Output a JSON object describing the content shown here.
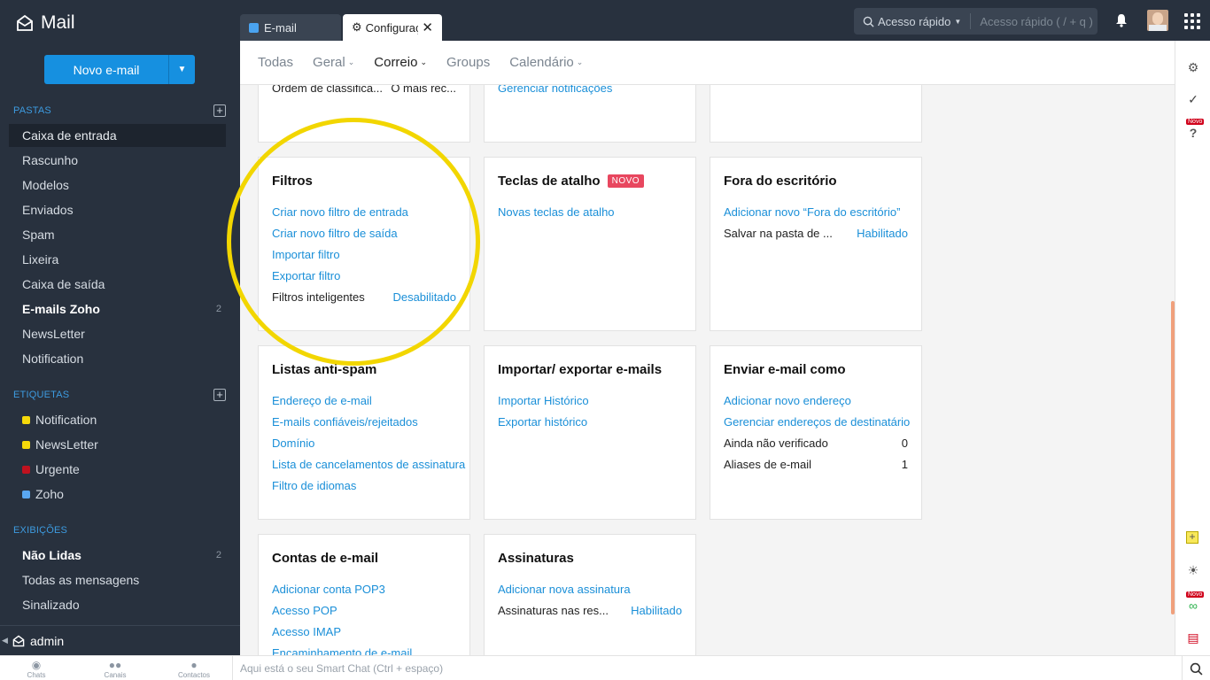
{
  "app": {
    "title": "Mail"
  },
  "sidebar": {
    "new_mail": "Novo e-mail",
    "folders_title": "PASTAS",
    "folders": [
      {
        "label": "Caixa de entrada",
        "count": ""
      },
      {
        "label": "Rascunho",
        "count": ""
      },
      {
        "label": "Modelos",
        "count": ""
      },
      {
        "label": "Enviados",
        "count": ""
      },
      {
        "label": "Spam",
        "count": ""
      },
      {
        "label": "Lixeira",
        "count": ""
      },
      {
        "label": "Caixa de saída",
        "count": ""
      },
      {
        "label": "E-mails Zoho",
        "count": "2"
      },
      {
        "label": "NewsLetter",
        "count": ""
      },
      {
        "label": "Notification",
        "count": ""
      }
    ],
    "tags_title": "ETIQUETAS",
    "tags": [
      {
        "label": "Notification",
        "color": "#f5d90a"
      },
      {
        "label": "NewsLetter",
        "color": "#f5d90a"
      },
      {
        "label": "Urgente",
        "color": "#c0121f"
      },
      {
        "label": "Zoho",
        "color": "#5aa7f0"
      }
    ],
    "views_title": "EXIBIÇÕES",
    "views": [
      {
        "label": "Não Lidas",
        "count": "2"
      },
      {
        "label": "Todas as mensagens",
        "count": ""
      },
      {
        "label": "Sinalizado",
        "count": ""
      }
    ],
    "user": "admin"
  },
  "tabs": {
    "email": "E-mail",
    "config": "Configurações"
  },
  "search": {
    "quick": "Acesso rápido",
    "placeholder": "Acesso rápido  ( / + q )"
  },
  "subnav": {
    "all": "Todas",
    "general": "Geral",
    "mail": "Correio",
    "groups": "Groups",
    "calendar": "Calendário"
  },
  "cards": {
    "top1": {
      "k": "Ordem de classifica...",
      "v": "O mais rec..."
    },
    "top2": {
      "link": "Gerenciar notificações"
    },
    "filters": {
      "title": "Filtros",
      "links": [
        "Criar novo filtro de entrada",
        "Criar novo filtro de saída",
        "Importar filtro",
        "Exportar filtro"
      ],
      "k": "Filtros inteligentes",
      "v": "Desabilitado"
    },
    "shortcuts": {
      "title": "Teclas de atalho",
      "badge": "NOVO",
      "links": [
        "Novas teclas de atalho"
      ]
    },
    "ooo": {
      "title": "Fora do escritório",
      "links": [
        "Adicionar novo “Fora do escritório”"
      ],
      "k": "Salvar na pasta de ...",
      "v": "Habilitado"
    },
    "antispam": {
      "title": "Listas anti-spam",
      "links": [
        "Endereço de e-mail",
        "E-mails confiáveis/rejeitados",
        "Domínio",
        "Lista de cancelamentos de assinatura",
        "Filtro de idiomas"
      ]
    },
    "importexport": {
      "title": "Importar/ exportar e-mails",
      "links": [
        "Importar Histórico",
        "Exportar histórico"
      ]
    },
    "sendas": {
      "title": "Enviar e-mail como",
      "links": [
        "Adicionar novo endereço",
        "Gerenciar endereços de destinatário"
      ],
      "rows": [
        {
          "k": "Ainda não verificado",
          "v": "0"
        },
        {
          "k": "Aliases de e-mail",
          "v": "1"
        }
      ]
    },
    "accounts": {
      "title": "Contas de e-mail",
      "links": [
        "Adicionar conta POP3",
        "Acesso POP",
        "Acesso IMAP",
        "Encaminhamento de e-mail"
      ]
    },
    "signatures": {
      "title": "Assinaturas",
      "links": [
        "Adicionar nova assinatura"
      ],
      "k": "Assinaturas nas res...",
      "v": "Habilitado"
    }
  },
  "rail": {
    "new1": "Novo",
    "new2": "Novo"
  },
  "bottom": {
    "chats": "Chats",
    "channels": "Canais",
    "contacts": "Contactos",
    "smartchat": "Aqui está o seu Smart Chat (Ctrl + espaço)"
  }
}
